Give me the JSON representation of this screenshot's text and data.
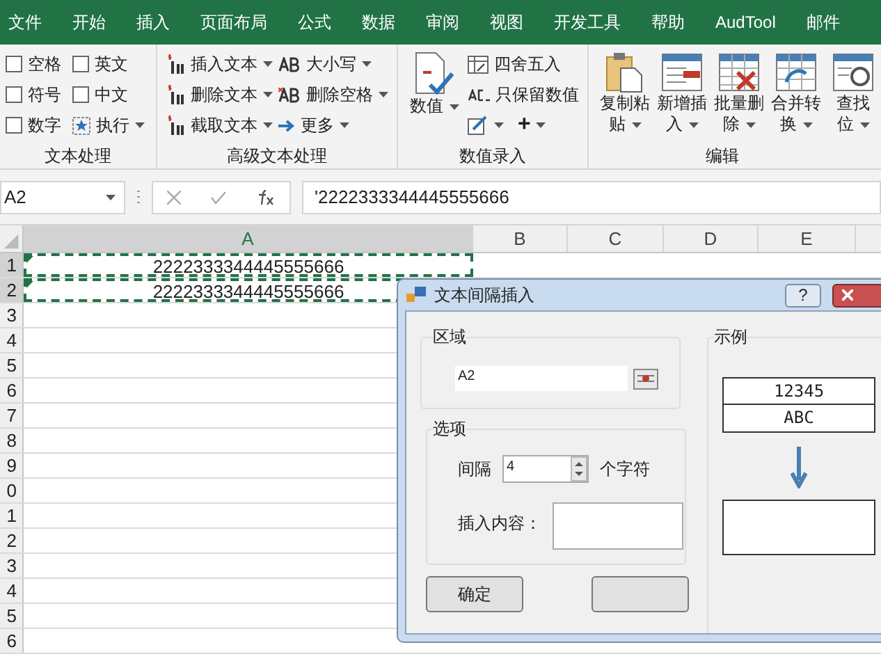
{
  "tabs": [
    {
      "label": "文件"
    },
    {
      "label": "开始"
    },
    {
      "label": "插入"
    },
    {
      "label": "页面布局"
    },
    {
      "label": "公式"
    },
    {
      "label": "数据"
    },
    {
      "label": "审阅"
    },
    {
      "label": "视图"
    },
    {
      "label": "开发工具"
    },
    {
      "label": "帮助"
    },
    {
      "label": "AudTool"
    },
    {
      "label": "邮件"
    }
  ],
  "ribbon": {
    "groups": [
      {
        "title": "文本处理",
        "items": [
          {
            "kind": "checkbox",
            "label": "空格",
            "checked": false
          },
          {
            "kind": "checkbox",
            "label": "英文",
            "checked": false
          },
          {
            "kind": "checkbox",
            "label": "符号",
            "checked": false
          },
          {
            "kind": "checkbox",
            "label": "中文",
            "checked": false
          },
          {
            "kind": "checkbox",
            "label": "数字",
            "checked": false
          },
          {
            "kind": "button",
            "label": "执行",
            "dropdown": true
          }
        ]
      },
      {
        "title": "高级文本处理",
        "items": [
          {
            "kind": "button",
            "label": "插入文本",
            "dropdown": true
          },
          {
            "kind": "button",
            "label": "大小写",
            "dropdown": true
          },
          {
            "kind": "button",
            "label": "删除文本",
            "dropdown": true
          },
          {
            "kind": "button",
            "label": "删除空格",
            "dropdown": true
          },
          {
            "kind": "button",
            "label": "截取文本",
            "dropdown": true
          },
          {
            "kind": "button",
            "label": "更多",
            "dropdown": true
          }
        ]
      },
      {
        "title": "数值录入",
        "items": [
          {
            "kind": "large",
            "lines": [
              "数值"
            ],
            "dropdown": true
          },
          {
            "kind": "button",
            "label": "四舍五入",
            "dropdown": false
          },
          {
            "kind": "button",
            "label": "只保留数值",
            "dropdown": false
          },
          {
            "kind": "iconbutton",
            "dropdown": true
          },
          {
            "kind": "iconbutton",
            "label": "+",
            "dropdown": true
          }
        ]
      },
      {
        "title": "编辑",
        "items": [
          {
            "kind": "large",
            "lines": [
              "复制粘",
              "贴"
            ],
            "dropdown": true
          },
          {
            "kind": "large",
            "lines": [
              "新增插",
              "入"
            ],
            "dropdown": true
          },
          {
            "kind": "large",
            "lines": [
              "批量删",
              "除"
            ],
            "dropdown": true
          },
          {
            "kind": "large",
            "lines": [
              "合并转",
              "换"
            ],
            "dropdown": true
          },
          {
            "kind": "large",
            "lines": [
              "查找",
              "位"
            ],
            "dropdown": true
          }
        ]
      }
    ]
  },
  "formula_bar": {
    "name_box": "A2",
    "formula": "'2222333344445555666"
  },
  "sheet": {
    "columns": [
      "A",
      "B",
      "C",
      "D",
      "E"
    ],
    "rows": [
      {
        "label": "1",
        "cells": [
          {
            "value": "2222333344445555666",
            "copied": true,
            "number_as_text": true
          }
        ]
      },
      {
        "label": "2",
        "cells": [
          {
            "value": "2222333344445555666",
            "copied": true,
            "number_as_text": true
          }
        ]
      },
      {
        "label": "3"
      },
      {
        "label": "4"
      },
      {
        "label": "5"
      },
      {
        "label": "6"
      },
      {
        "label": "7"
      },
      {
        "label": "8"
      },
      {
        "label": "9"
      },
      {
        "label": "0"
      },
      {
        "label": "1"
      },
      {
        "label": "2"
      },
      {
        "label": "3"
      },
      {
        "label": "4"
      },
      {
        "label": "5"
      },
      {
        "label": "6"
      }
    ]
  },
  "dialog": {
    "title": "文本间隔插入",
    "help": "?",
    "range": {
      "label": "区域",
      "value": "A2"
    },
    "options": {
      "label": "选项",
      "interval_label": "间隔",
      "interval": "4",
      "unit": "个字符",
      "insert_label": "插入内容："
    },
    "example": {
      "label": "示例",
      "lines": [
        "12345",
        "ABC"
      ]
    },
    "buttons": [
      {
        "kind": "text",
        "label": "确定"
      },
      {
        "kind": "blank"
      }
    ]
  }
}
